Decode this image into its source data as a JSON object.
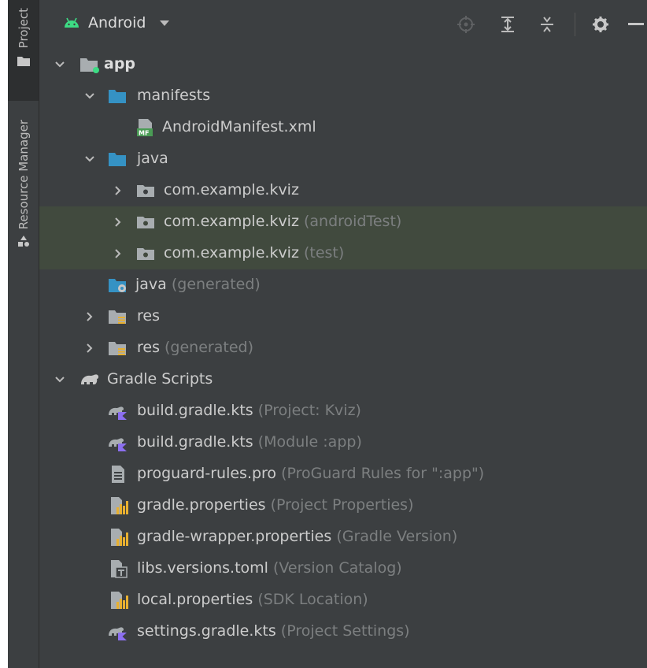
{
  "side_stripe": {
    "project_label": "Project",
    "resource_manager_label": "Resource Manager"
  },
  "toolbar": {
    "view_mode": "Android",
    "icons": [
      "locate-icon",
      "expand-all-icon",
      "collapse-all-icon",
      "settings-icon",
      "hide-icon"
    ]
  },
  "colors": {
    "background": "#3c3f41",
    "highlight_row": "#414a3e",
    "hint_text": "#7c7f80",
    "folder_blue": "#3592c4",
    "android_green": "#3ddc84"
  },
  "tree": {
    "app": {
      "name": "app"
    },
    "manifests": {
      "name": "manifests"
    },
    "manifest_file": {
      "name": "AndroidManifest.xml"
    },
    "java": {
      "name": "java"
    },
    "pkg_main": {
      "name": "com.example.kviz",
      "hint": ""
    },
    "pkg_android_test": {
      "name": "com.example.kviz",
      "hint": " (androidTest)"
    },
    "pkg_test": {
      "name": "com.example.kviz",
      "hint": " (test)"
    },
    "java_generated": {
      "name": "java",
      "hint": " (generated)"
    },
    "res": {
      "name": "res"
    },
    "res_generated": {
      "name": "res",
      "hint": " (generated)"
    },
    "gradle_scripts": {
      "name": "Gradle Scripts"
    },
    "build_project": {
      "name": "build.gradle.kts",
      "hint": " (Project: Kviz)"
    },
    "build_module": {
      "name": "build.gradle.kts",
      "hint": " (Module :app)"
    },
    "proguard": {
      "name": "proguard-rules.pro",
      "hint": " (ProGuard Rules for \":app\")"
    },
    "gradle_props": {
      "name": "gradle.properties",
      "hint": " (Project Properties)"
    },
    "wrapper_props": {
      "name": "gradle-wrapper.properties",
      "hint": " (Gradle Version)"
    },
    "libs_versions": {
      "name": "libs.versions.toml",
      "hint": " (Version Catalog)"
    },
    "local_props": {
      "name": "local.properties",
      "hint": " (SDK Location)"
    },
    "settings_gradle": {
      "name": "settings.gradle.kts",
      "hint": " (Project Settings)"
    }
  }
}
